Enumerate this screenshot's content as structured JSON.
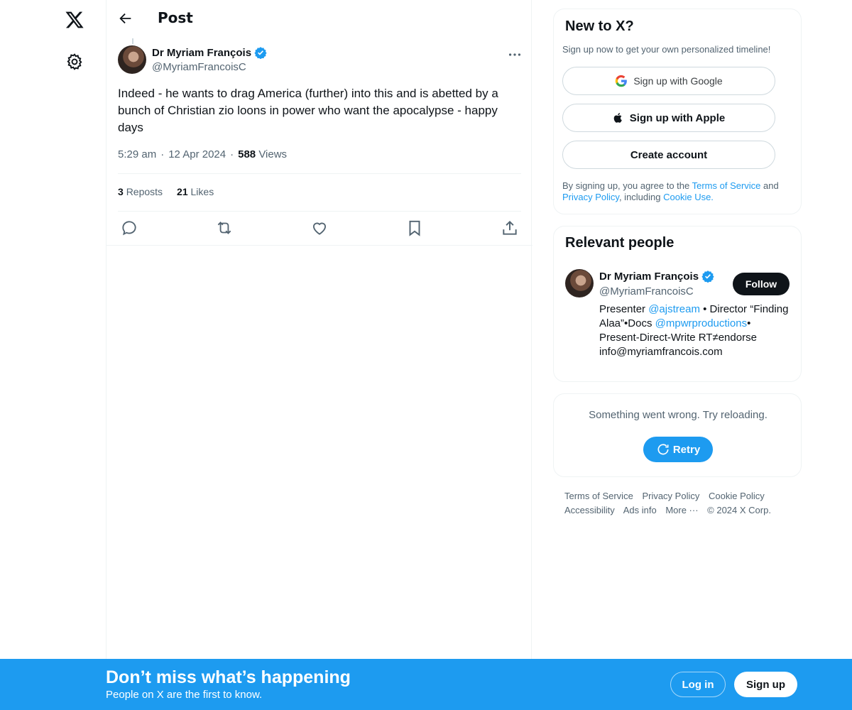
{
  "header": {
    "title": "Post"
  },
  "post": {
    "author_name": "Dr Myriam François",
    "author_handle": "@MyriamFrancoisC",
    "text": "Indeed - he wants to drag America (further) into this and is abetted by a bunch of Christian zio loons in power who want the apocalypse - happy days",
    "time": "5:29 am",
    "dot1": "·",
    "date": "12 Apr 2024",
    "dot2": "·",
    "views_count": "588",
    "views_label": "Views",
    "reposts_count": "3",
    "reposts_label": "Reposts",
    "likes_count": "21",
    "likes_label": "Likes"
  },
  "signup_card": {
    "title": "New to X?",
    "subtitle": "Sign up now to get your own personalized timeline!",
    "google_label": "Sign up with Google",
    "apple_label": "Sign up with Apple",
    "create_label": "Create account",
    "terms_prefix": "By signing up, you agree to the ",
    "terms_link": "Terms of Service",
    "terms_and": " and ",
    "privacy_link": "Privacy Policy",
    "terms_including": ", including ",
    "cookie_link": "Cookie Use."
  },
  "people_card": {
    "title": "Relevant people",
    "name": "Dr Myriam François",
    "handle": "@MyriamFrancoisC",
    "follow_label": "Follow",
    "bio_1": "Presenter ",
    "bio_link1": "@ajstream",
    "bio_2": " • Director “Finding Alaa”•Docs ",
    "bio_link2": "@mpwrproductions",
    "bio_3": "• Present-Direct-Write RT≠endorse info@myriamfrancois.com"
  },
  "error_card": {
    "message": "Something went wrong. Try reloading.",
    "retry_label": "Retry"
  },
  "footer": {
    "links": [
      "Terms of Service",
      "Privacy Policy",
      "Cookie Policy",
      "Accessibility",
      "Ads info",
      "More ···",
      "© 2024 X Corp."
    ]
  },
  "banner": {
    "title": "Don’t miss what’s happening",
    "subtitle": "People on X are the first to know.",
    "login_label": "Log in",
    "signup_label": "Sign up"
  },
  "colors": {
    "accent": "#1d9bf0",
    "text": "#0f1419",
    "muted": "#536471",
    "border": "#eff3f4"
  }
}
